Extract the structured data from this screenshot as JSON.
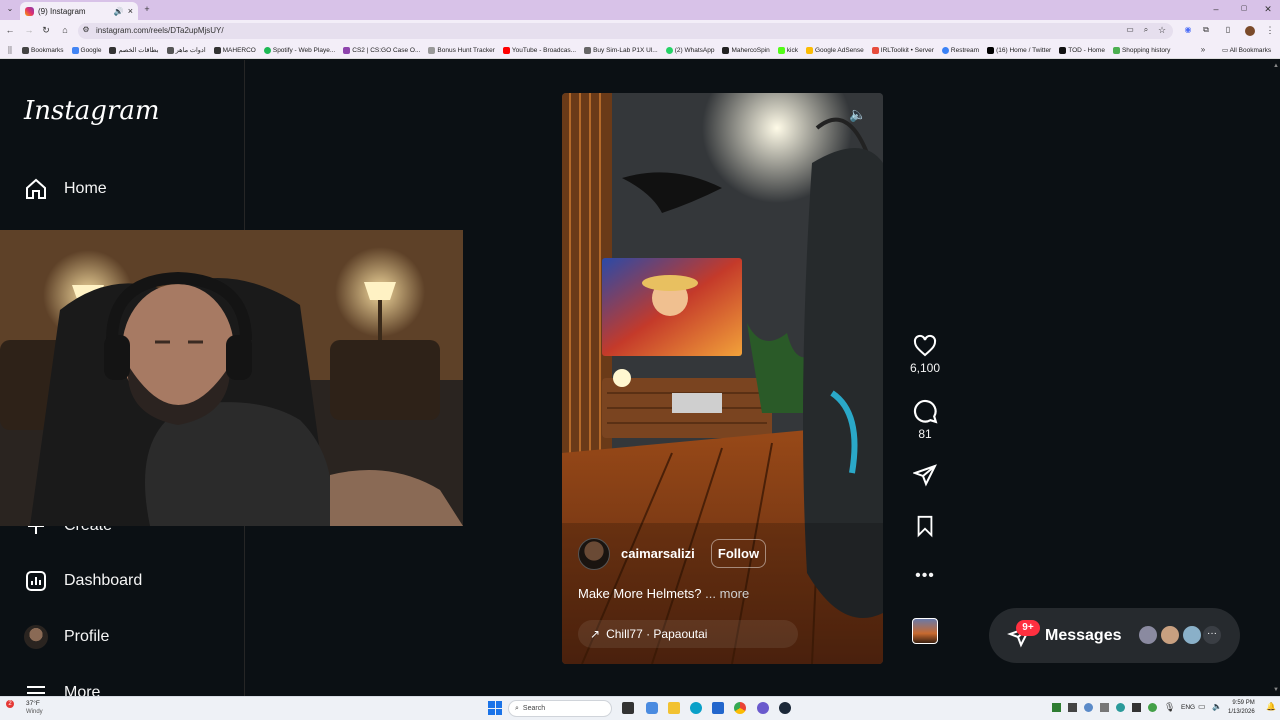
{
  "browser": {
    "tab_title": "(9) Instagram",
    "url": "instagram.com/reels/DTa2upMjsUY/",
    "bookmarks": [
      {
        "label": "Bookmarks",
        "color": "#444"
      },
      {
        "label": "Google",
        "color": "#4285f4"
      },
      {
        "label": "بطاقات الخصم",
        "color": "#333"
      },
      {
        "label": "ادوات ماهر",
        "color": "#555"
      },
      {
        "label": "MAHERCO",
        "color": "#333"
      },
      {
        "label": "Spotify - Web Playe...",
        "color": "#1db954"
      },
      {
        "label": "CS2 | CS:GO Case O...",
        "color": "#8e44ad"
      },
      {
        "label": "Bonus Hunt Tracker",
        "color": "#999"
      },
      {
        "label": "YouTube - Broadcas...",
        "color": "#ff0000"
      },
      {
        "label": "Buy Sim-Lab P1X Ul...",
        "color": "#666"
      },
      {
        "label": "(2) WhatsApp",
        "color": "#25d366"
      },
      {
        "label": "MahercoSpin",
        "color": "#222"
      },
      {
        "label": "kick",
        "color": "#53fc18"
      },
      {
        "label": "Google AdSense",
        "color": "#fbbc04"
      },
      {
        "label": "IRLToolkit • Server",
        "color": "#e74c3c"
      },
      {
        "label": "Restream",
        "color": "#3b82f6"
      },
      {
        "label": "(16) Home / Twitter",
        "color": "#000"
      },
      {
        "label": "TOD - Home",
        "color": "#111"
      },
      {
        "label": "Shopping history",
        "color": "#4caf50"
      }
    ],
    "all_bookmarks": "All Bookmarks"
  },
  "sidebar": {
    "logo": "Instagram",
    "home": "Home",
    "create": "Create",
    "dashboard": "Dashboard",
    "profile": "Profile",
    "more": "More"
  },
  "reel": {
    "username": "caimarsalizi",
    "follow": "Follow",
    "caption": "Make More Helmets?",
    "more": "... more",
    "audio": "Chill77 · Papaoutai",
    "likes": "6,100",
    "comments": "81"
  },
  "messages": {
    "label": "Messages",
    "badge": "9+"
  },
  "taskbar": {
    "weather_temp": "37°F",
    "weather_desc": "Windy",
    "weather_badge": "2",
    "search": "Search",
    "lang": "ENG",
    "time": "9:59 PM",
    "date": "1/13/2026"
  },
  "colors": {
    "accent": "#0095f6",
    "badge": "#ff3040",
    "sidebar_bg": "#0b1014"
  }
}
